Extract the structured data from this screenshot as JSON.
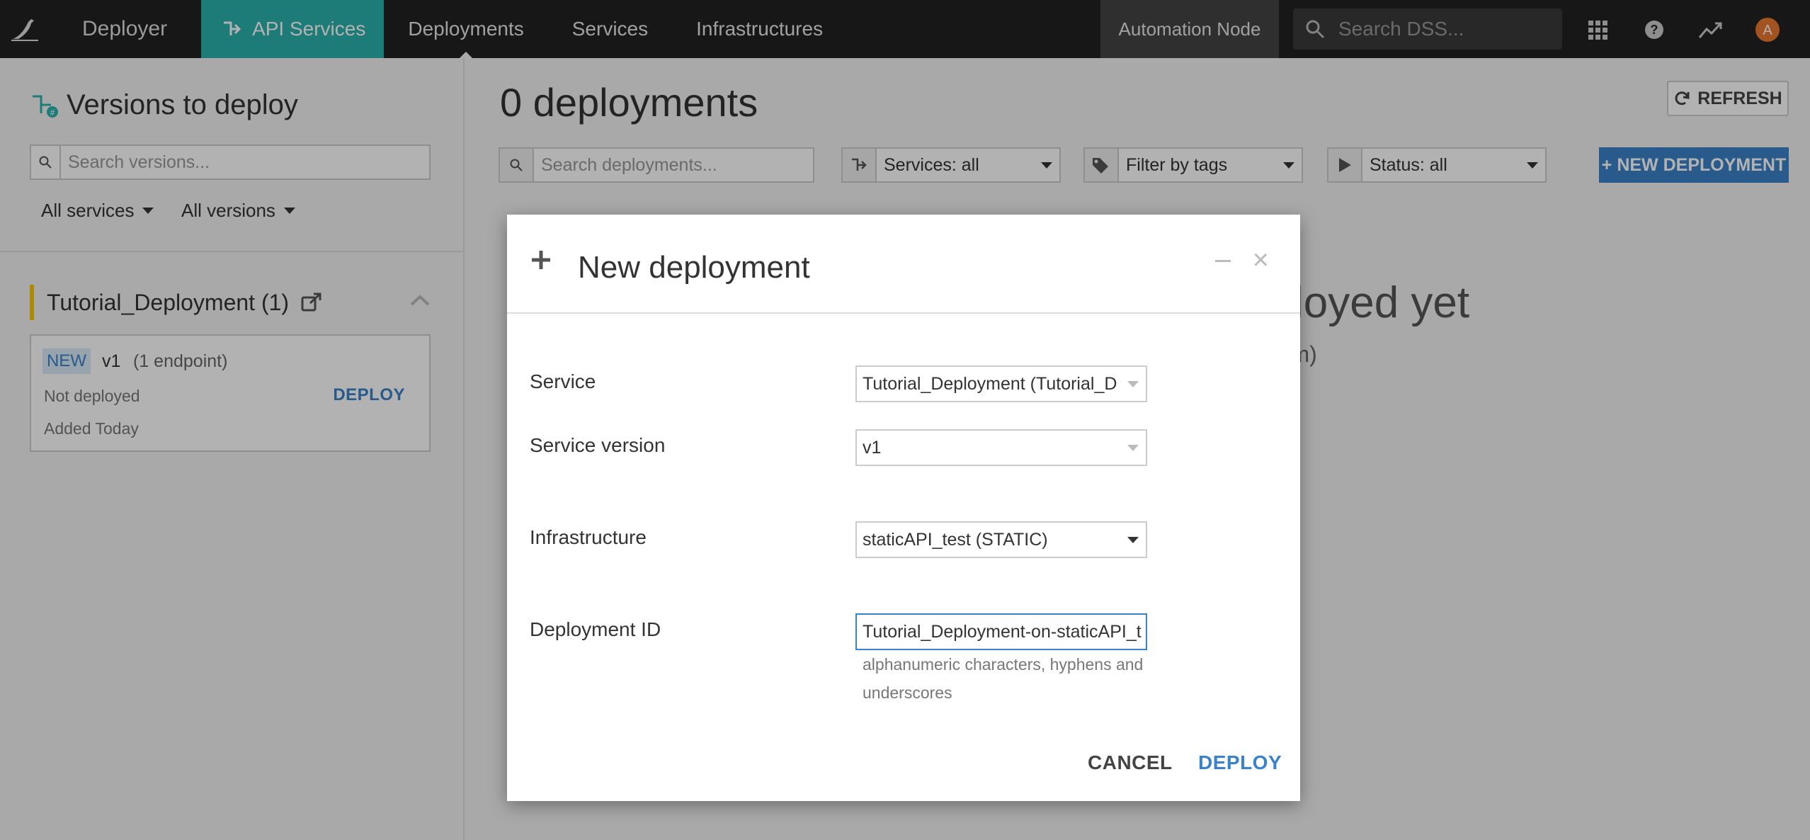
{
  "topnav": {
    "app_name": "Deployer",
    "tabs": [
      {
        "label": "API Services",
        "active": true
      },
      {
        "label": "Deployments",
        "current": true
      },
      {
        "label": "Services"
      },
      {
        "label": "Infrastructures"
      }
    ],
    "node_label": "Automation Node",
    "search_placeholder": "Search DSS...",
    "avatar_letter": "A",
    "accent_color": "#2ab1ac",
    "avatar_color": "#e8772e"
  },
  "sidebar": {
    "title": "Versions to deploy",
    "search_placeholder": "Search versions...",
    "filter_services": "All services",
    "filter_versions": "All versions",
    "group": {
      "name": "Tutorial_Deployment (1)",
      "versions": [
        {
          "badge": "NEW",
          "name": "v1",
          "endpoints": "(1 endpoint)",
          "status": "Not deployed",
          "added": "Added Today",
          "action": "DEPLOY"
        }
      ]
    }
  },
  "main": {
    "title": "0 deployments",
    "refresh_label": "REFRESH",
    "search_placeholder": "Search deployments...",
    "services_filter": "Services: all",
    "tags_filter": "Filter by tags",
    "status_filter": "Status: all",
    "new_button": "+ NEW DEPLOYMENT",
    "empty_title_visible": "eployed yet",
    "empty_sub_visible": "them)"
  },
  "modal": {
    "title": "New deployment",
    "fields": {
      "service_label": "Service",
      "service_value": "Tutorial_Deployment (Tutorial_De",
      "version_label": "Service version",
      "version_value": "v1",
      "infra_label": "Infrastructure",
      "infra_value": "staticAPI_test (STATIC)",
      "id_label": "Deployment ID",
      "id_value": "Tutorial_Deployment-on-staticAPI_t",
      "id_help": "alphanumeric characters, hyphens and underscores"
    },
    "cancel_label": "CANCEL",
    "deploy_label": "DEPLOY"
  },
  "colors": {
    "primary": "#3a82c9",
    "new_badge_bg": "#d8eaf8",
    "group_marker": "#f5c500"
  }
}
